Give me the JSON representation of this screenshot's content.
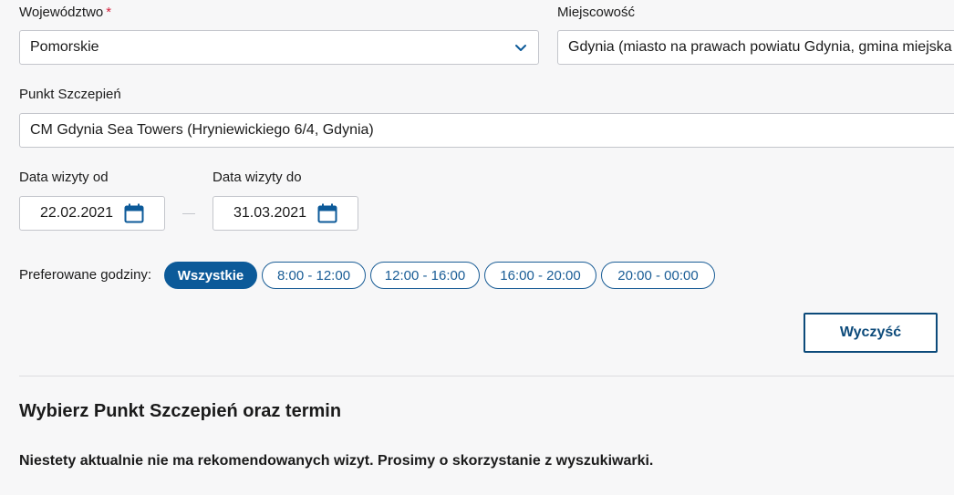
{
  "form": {
    "voivodeship": {
      "label": "Województwo",
      "required_mark": "*",
      "value": "Pomorskie"
    },
    "city": {
      "label": "Miejscowość",
      "value": "Gdynia (miasto na prawach powiatu Gdynia, gmina miejska"
    },
    "vaccination_point": {
      "label": "Punkt Szczepień",
      "value": "CM Gdynia Sea Towers (Hryniewickiego 6/4, Gdynia)"
    },
    "date_from": {
      "label": "Data wizyty od",
      "value": "22.02.2021"
    },
    "date_to": {
      "label": "Data wizyty do",
      "value": "31.03.2021"
    },
    "preferred_hours": {
      "label": "Preferowane godziny:",
      "options": [
        "Wszystkie",
        "8:00 - 12:00",
        "12:00 - 16:00",
        "16:00 - 20:00",
        "20:00 - 00:00"
      ],
      "selected": "Wszystkie"
    },
    "clear_label": "Wyczyść"
  },
  "results": {
    "title": "Wybierz Punkt Szczepień oraz termin",
    "notice": "Niestety aktualnie nie ma rekomendowanych wizyt. Prosimy o skorzystanie z wyszukiwarki."
  },
  "colors": {
    "accent": "#0c5a99",
    "required": "#d4213d",
    "background": "#f7f7f8"
  }
}
